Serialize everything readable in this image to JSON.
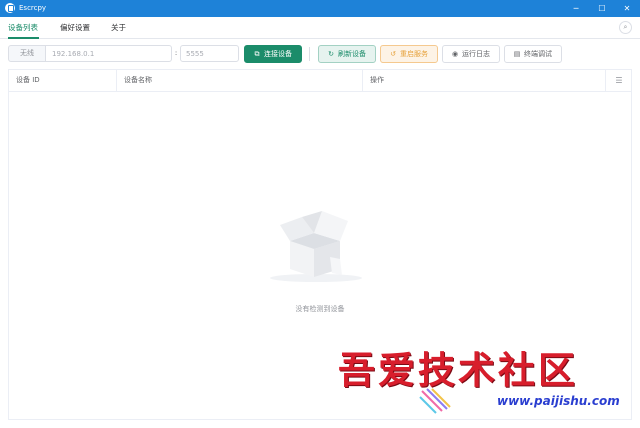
{
  "window": {
    "title": "Escrcpy",
    "minimize_glyph": "─",
    "maximize_glyph": "☐",
    "close_glyph": "✕"
  },
  "tabs": [
    {
      "label": "设备列表",
      "active": true
    },
    {
      "label": "偏好设置",
      "active": false
    },
    {
      "label": "关于",
      "active": false
    }
  ],
  "toolbar": {
    "wireless_label": "无线",
    "ip_placeholder": "192.168.0.1",
    "separator": ":",
    "port_placeholder": "5555",
    "connect_label": "连接设备",
    "refresh_label": "刷新设备",
    "restart_label": "重启服务",
    "log_label": "运行日志",
    "terminal_label": "终端调试"
  },
  "table": {
    "columns": [
      "设备 ID",
      "设备名称",
      "操作"
    ],
    "rows": [],
    "empty_text": "没有检测到设备"
  },
  "watermark": {
    "title": "吾爱技术社区",
    "url": "www.paijishu.com"
  },
  "colors": {
    "titlebar": "#1e82d8",
    "primary": "#1b8c6a",
    "warning": "#e6a23c",
    "watermark_red": "#d81e2c",
    "watermark_blue": "#2a3ed0"
  },
  "icons": {
    "app": "escrcpy-logo-icon",
    "connect": "link-icon",
    "refresh": "refresh-icon",
    "restart": "restart-icon",
    "log": "eye-icon",
    "terminal": "terminal-icon",
    "search": "search-icon",
    "columns": "column-settings-icon",
    "empty": "empty-box-icon"
  }
}
